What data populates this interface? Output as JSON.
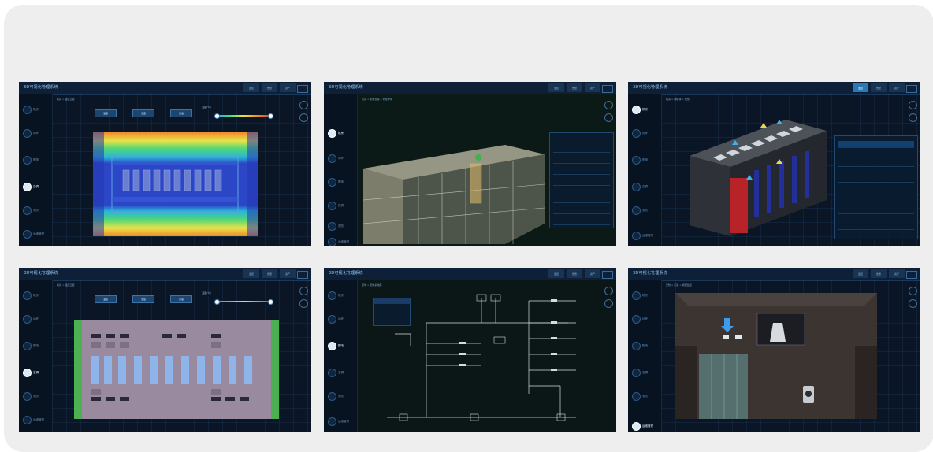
{
  "screens": [
    {
      "title": "3D可视化管理系统",
      "breadcrumb": "机房 > 温度云图",
      "tabs": [
        "监控",
        "告警",
        "资产"
      ],
      "active_tab": -1,
      "nav": [
        "机房",
        "动环",
        "配电",
        "空调",
        "安防",
        "运维管理"
      ],
      "active_nav": 3,
      "buttons": [
        "温度",
        "湿度",
        "风速"
      ],
      "legend_title": "温度(℃)"
    },
    {
      "title": "3D可视化管理系统",
      "breadcrumb": "机房 > 机柜管理 > 机柜详情",
      "tabs": [
        "监控",
        "告警",
        "资产"
      ],
      "active_tab": -1,
      "nav": [
        "机房",
        "动环",
        "配电",
        "空调",
        "安防",
        "运维管理"
      ],
      "active_nav": 0
    },
    {
      "title": "3D可视化管理系统",
      "breadcrumb": "机房 > 微模块 > 告警",
      "tabs": [
        "监控",
        "告警",
        "资产"
      ],
      "active_tab": 0,
      "nav": [
        "机房",
        "动环",
        "配电",
        "空调",
        "安防",
        "运维管理"
      ],
      "active_nav": 0
    },
    {
      "title": "3D可视化管理系统",
      "breadcrumb": "机房 > 温度云图",
      "tabs": [
        "监控",
        "告警",
        "资产"
      ],
      "active_tab": -1,
      "nav": [
        "机房",
        "动环",
        "配电",
        "空调",
        "安防",
        "运维管理"
      ],
      "active_nav": 3,
      "buttons": [
        "温度",
        "湿度",
        "风速"
      ],
      "legend_title": "温度(℃)"
    },
    {
      "title": "3D可视化管理系统",
      "breadcrumb": "配电 > 配电系统图",
      "tabs": [
        "监控",
        "告警",
        "资产"
      ],
      "active_tab": -1,
      "nav": [
        "机房",
        "动环",
        "配电",
        "空调",
        "安防",
        "运维管理"
      ],
      "active_nav": 2
    },
    {
      "title": "3D可视化管理系统",
      "breadcrumb": "安防 > 门禁 > 视频监控",
      "tabs": [
        "监控",
        "告警",
        "资产"
      ],
      "active_tab": -1,
      "nav": [
        "机房",
        "动环",
        "配电",
        "空调",
        "安防",
        "运维管理"
      ],
      "active_nav": 5
    }
  ]
}
